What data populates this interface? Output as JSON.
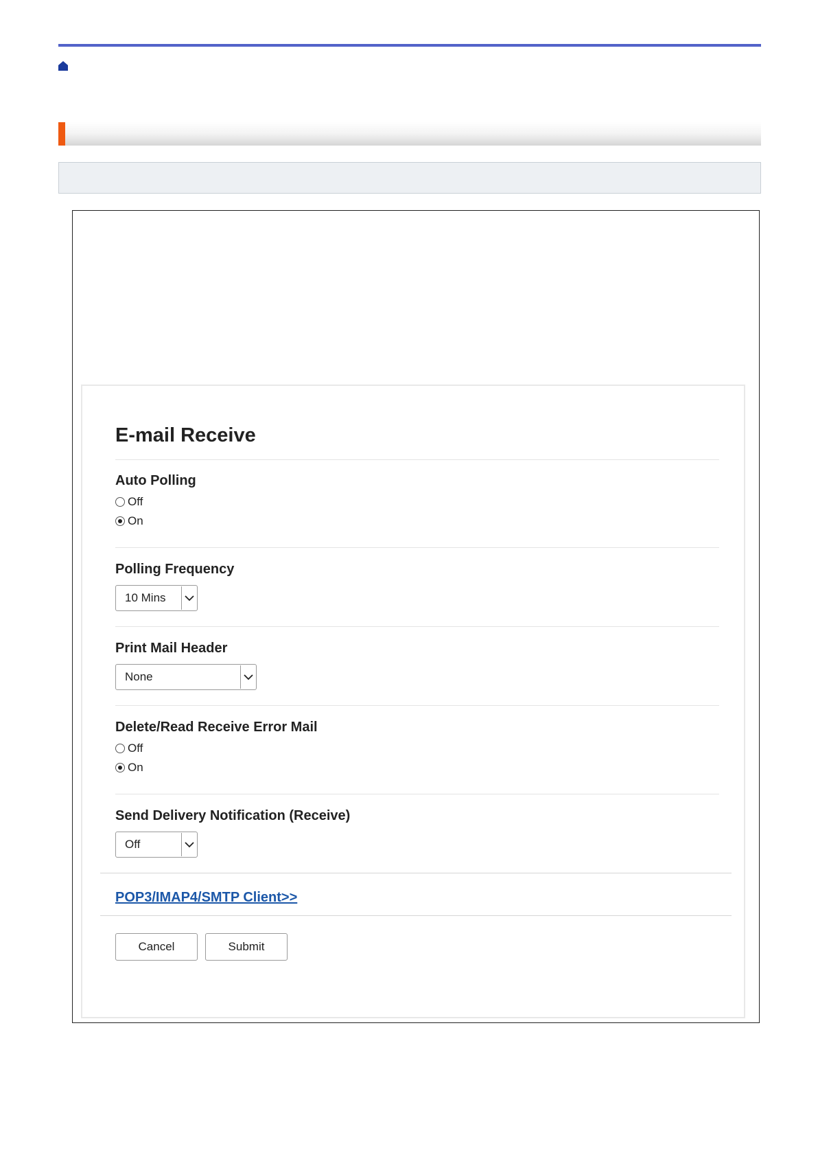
{
  "page": {
    "title": "E-mail Receive"
  },
  "auto_polling": {
    "label": "Auto Polling",
    "options": [
      "Off",
      "On"
    ],
    "selected": "On"
  },
  "polling_frequency": {
    "label": "Polling Frequency",
    "value": "10 Mins"
  },
  "print_mail_header": {
    "label": "Print Mail Header",
    "value": "None"
  },
  "delete_read_error_mail": {
    "label": "Delete/Read Receive Error Mail",
    "options": [
      "Off",
      "On"
    ],
    "selected": "On"
  },
  "send_delivery_notification": {
    "label": "Send Delivery Notification (Receive)",
    "value": "Off"
  },
  "links": {
    "client_settings": "POP3/IMAP4/SMTP Client>>"
  },
  "buttons": {
    "cancel": "Cancel",
    "submit": "Submit"
  },
  "colors": {
    "top_rule": "#5363c9",
    "section_accent": "#ef5a12",
    "link": "#1b57a8",
    "home_icon": "#1a3a9c"
  },
  "icons": {
    "home": "home-icon",
    "dropdown": "chevron-down-icon"
  }
}
